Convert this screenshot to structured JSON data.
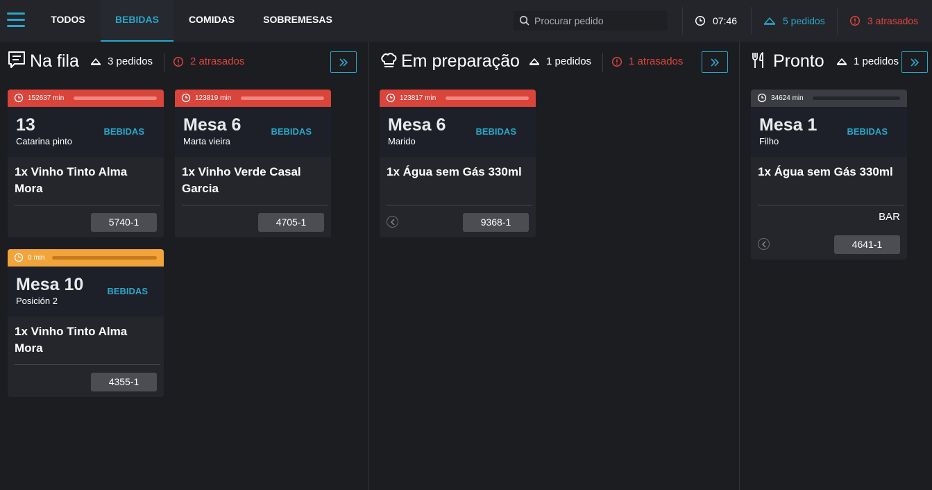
{
  "topbar": {
    "tabs": [
      {
        "label": "TODOS"
      },
      {
        "label": "BEBIDAS",
        "active": true
      },
      {
        "label": "COMIDAS"
      },
      {
        "label": "SOBREMESAS"
      }
    ],
    "search_placeholder": "Procurar pedido",
    "clock": "07:46",
    "orders_total": "5 pedidos",
    "orders_late": "3 atrasados"
  },
  "columns": [
    {
      "title": "Na fila",
      "count": "3 pedidos",
      "late": "2 atrasados",
      "icon": "receipt-icon",
      "cards": [
        {
          "minutes": "152637 min",
          "status": "late",
          "table": "13",
          "customer": "Catarina pinto",
          "category": "BEBIDAS",
          "item": "1x Vinho Tinto Alma Mora",
          "order_id": "5740-1"
        },
        {
          "minutes": "123819 min",
          "status": "late",
          "table": "Mesa 6",
          "customer": "Marta vieira",
          "category": "BEBIDAS",
          "item": "1x Vinho Verde Casal Garcia",
          "order_id": "4705-1"
        },
        {
          "minutes": "0 min",
          "status": "warning",
          "table": "Mesa 10",
          "customer": "Posición 2",
          "category": "BEBIDAS",
          "item": "1x Vinho Tinto Alma Mora",
          "order_id": "4355-1"
        }
      ]
    },
    {
      "title": "Em preparação",
      "count": "1 pedidos",
      "late": "1 atrasados",
      "icon": "chef-hat-icon",
      "cards": [
        {
          "minutes": "123817 min",
          "status": "late",
          "table": "Mesa 6",
          "customer": "Marido",
          "category": "BEBIDAS",
          "item": "1x Água sem Gás 330ml",
          "order_id": "9368-1"
        }
      ]
    },
    {
      "title": "Pronto",
      "count": "1 pedidos",
      "icon": "cutlery-icon",
      "cards": [
        {
          "minutes": "34624 min",
          "status": "normal",
          "table": "Mesa 1",
          "customer": "Filho",
          "category": "BEBIDAS",
          "item": "1x Água sem Gás 330ml",
          "station": "BAR",
          "order_id": "4641-1"
        }
      ]
    }
  ],
  "colors": {
    "accent": "#2aa6c9",
    "late": "#d9443b",
    "warning": "#f0a43a",
    "late_text": "#e0443b"
  }
}
